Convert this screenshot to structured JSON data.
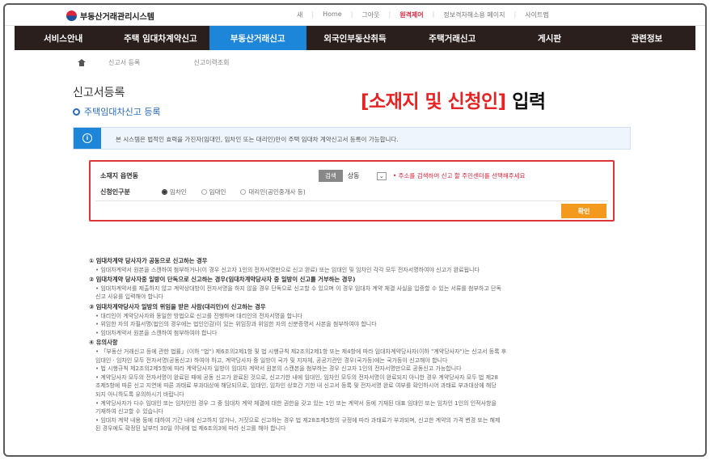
{
  "header": {
    "logo_text": "부동산거래관리시스템",
    "links": [
      {
        "label": "새"
      },
      {
        "label": "Home"
      },
      {
        "label": "그아웃"
      },
      {
        "label": "원격제어",
        "highlight": true
      },
      {
        "label": "정보격차해소용 페이지"
      },
      {
        "label": "사이트맵"
      }
    ]
  },
  "nav": {
    "items": [
      {
        "label": "서비스안내"
      },
      {
        "label": "주택 임대차계약신고"
      },
      {
        "label": "부동산거래신고",
        "active": true
      },
      {
        "label": "외국인부동산취득"
      },
      {
        "label": "주택거래신고"
      },
      {
        "label": "게시판"
      },
      {
        "label": "관련정보"
      }
    ]
  },
  "breadcrumb": {
    "items": [
      "신고서 등록",
      "신고이력조회"
    ]
  },
  "page": {
    "title": "신고서등록",
    "subtitle": "주택임대차신고 등록"
  },
  "overlay": {
    "red_text": "[소재지 및 신청인]",
    "black_text": "입력"
  },
  "notice": {
    "text": "본 시스템은 법적인 효력을 가진자(임대인, 임차인 또는 대리인)만이 주택 임대차 계약신고서 등록이 가능합니다."
  },
  "form": {
    "location_label": "소재지 읍면동",
    "search_label": "검색",
    "select_value": "상동",
    "warning": "• 주소를 검색하여 신고 할 주민센터를 선택해주세요",
    "applicant_label": "신청인구분",
    "options": [
      {
        "label": "임차인",
        "selected": true
      },
      {
        "label": "임대인",
        "selected": false
      },
      {
        "label": "대리인(공인중개사 등)",
        "selected": false
      }
    ],
    "confirm_label": "확인"
  },
  "guide": {
    "sections": [
      {
        "title": "① 임대차계약 당사자가 공동으로 신고하는 경우",
        "bullets": [
          "• 임대차계약서 원본을 스캔하여 첨부하거나(이 경우 신고자 1인의 전자서명만으로 신고 완료) 또는 임대인 및 임차인 각각 모두 전자서명하여야 신고가 완료됩니다"
        ]
      },
      {
        "title": "② 임대차계약 당사자중 일방이 단독으로 신고하는 경우(임대차계약당사자 중 일방이 신고를 거부하는 경우)",
        "bullets": [
          "• 임대차계약서를 제출하지 않고 계약상대방이 전자서명을 하지 않을 경우 단독으로 신고할 수 있으며 이 경우 임대차 계약 체결 사실을 입증할 수 있는 서류를 첨부하고 단독",
          "  신고 사유를 입력해야 합니다"
        ]
      },
      {
        "title": "③ 임대차계약당사자 일방의 위임을 받은 사람(대리인)이 신고하는 경우",
        "bullets": [
          "• 대리인이 계약당사자와 동일한 방법으로 신고를 진행하며 대리인의 전자서명을 합니다",
          "• 위임한 자의 자필서명(법인의 경우에는 법인인감)이 있는 위임장과 위임한 자의 신분증명서 사본을 첨부하여야 합니다",
          "• 임대차계약서 원본을 스캔하여 첨부하여야 합니다"
        ]
      },
      {
        "title": "④ 유의사항",
        "bullets": [
          "• 「부동산 거래신고 등에 관한 법률」(이하 \"법\") 제6조의2제1항 및 법 시행규칙 제2조의2제1항 또는 제4항에 따라 임대차계약당사자(이하 \"계약당사자\")는 신고서 등록 후",
          "  임대인 · 임차인 모두 전자서명(공동신고) 하여야 하고, 계약당사자 중 일방이 국가 및 지자체, 공공기관인 경우(국가등)에는 국가등이 신고해야 합니다",
          "• 법 시행규칙 제2조의2제5항에 따라 계약당사자 일방이 임대차 계약서 원본의 스캔본을 첨부하는 경우 신고자 1인의 전자서명만으로 공동신고 가능합니다",
          "• 계약당사자 모두의 전자서명이 완료된 때에 공동 신고가 완료된 것으로, 신고기한 내에 임대인, 임차인 모두의 전자서명이 완료되지 아니한 경우 계약당사자 모두 법 제28",
          "  조제5항에 따른 신고 지연에 따른 과태료 부과대상에 해당되므로, 임대인, 임차인 상호간 기한 내 신고서 등록 및 전자서명 완료 여부를 확인하시어 과태료 부과대상에 해당",
          "  되지 아니하도록 유의하시기 바랍니다",
          "• 계약당사자가 다수 임대인 또는 임차인인 경우 그 중 임대차 계약 체결에 대한 권한을 갖고 있는 1인 또는 계약서 등에 기재된 대표 임대인 또는 임차인 1인의 인적사항을",
          "  기재하여 신고할 수 있습니다",
          "• 임대차 계약 내용 등에 대하여 기간 내에 신고하지 않거나, 거짓으로 신고하는 경우 법 제28조제5항의 규정에 따라 과태료가 부과되며, 신고한 계약의 가격 변경 또는 해제",
          "  된 경우에도 확정된 날부터 30일 이내에 법 제6조의3에 따라 신고를 해야 합니다"
        ]
      }
    ]
  }
}
